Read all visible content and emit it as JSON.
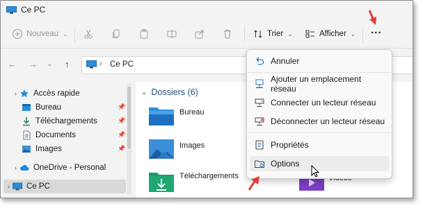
{
  "window": {
    "title": "Ce PC"
  },
  "toolbar": {
    "new_label": "Nouveau",
    "sort_label": "Trier",
    "view_label": "Afficher",
    "more_label": "..."
  },
  "address": {
    "path": "Ce PC"
  },
  "nav": {
    "items": [
      {
        "label": "Accès rapide"
      },
      {
        "label": "Bureau"
      },
      {
        "label": "Téléchargements"
      },
      {
        "label": "Documents"
      },
      {
        "label": "Images"
      },
      {
        "label": "OneDrive - Personal"
      },
      {
        "label": "Ce PC"
      }
    ]
  },
  "content": {
    "group_title": "Dossiers (6)",
    "folders": [
      {
        "label": "Bureau"
      },
      {
        "label": "Images"
      },
      {
        "label": "Téléchargements"
      },
      {
        "label": "Vidéos"
      }
    ]
  },
  "menu": {
    "items": [
      {
        "label": "Annuler"
      },
      {
        "label": "Ajouter un emplacement réseau"
      },
      {
        "label": "Connecter un lecteur réseau"
      },
      {
        "label": "Déconnecter un lecteur réseau"
      },
      {
        "label": "Propriétés"
      },
      {
        "label": "Options"
      }
    ]
  },
  "colors": {
    "accent": "#0067c0",
    "folder": "#f4c53d",
    "annotation_arrow": "#e53935"
  }
}
